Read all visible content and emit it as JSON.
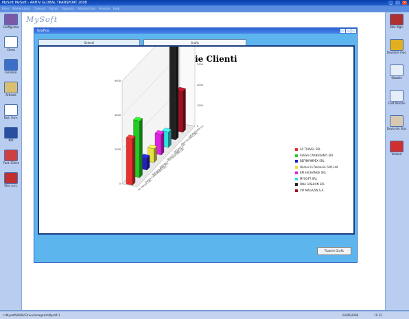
{
  "app": {
    "title": "MySoft MySoft - ARHIV GLOBAL TRANSPORT 2008",
    "menu": [
      "Fișier",
      "Nomenclator",
      "Comenzi",
      "Facturi",
      "Rapoarte",
      "Administrare",
      "Ferestre",
      "Help"
    ],
    "logo": "MySoft"
  },
  "left_toolbar": [
    {
      "label": "Configurare",
      "icon": "config-icon",
      "color": "#7a5aa8"
    },
    {
      "label": "Client",
      "icon": "client-icon",
      "color": "#ffffff"
    },
    {
      "label": "Furnizori",
      "icon": "supplier-icon",
      "color": "#3c6fc8"
    },
    {
      "label": "Articole",
      "icon": "article-icon",
      "color": "#d8c070"
    },
    {
      "label": "Fact. Furn.",
      "icon": "invoice-in-icon",
      "color": "#ffffff"
    },
    {
      "label": "NIR",
      "icon": "nir-icon",
      "color": "#2a4fa0"
    },
    {
      "label": "Fact. Client",
      "icon": "invoice-out-icon",
      "color": "#d04040"
    },
    {
      "label": "Stoc curs.",
      "icon": "stock-icon",
      "color": "#c03030"
    }
  ],
  "right_toolbar": [
    {
      "label": "Stoc dign.",
      "icon": "stock-diag-icon",
      "color": "#b03030"
    },
    {
      "label": "Devizare mas.",
      "icon": "crown-icon",
      "color": "#e0b020"
    },
    {
      "label": "Situatie",
      "icon": "report-icon",
      "color": "#e8eef8"
    },
    {
      "label": "Cost Vanzari",
      "icon": "sales-icon",
      "color": "#e8eef8"
    },
    {
      "label": "Deviz din Stoc",
      "icon": "person-icon",
      "color": "#d8c8b0"
    },
    {
      "label": "Vanzari",
      "icon": "bag-icon",
      "color": "#d03030"
    }
  ],
  "window": {
    "title": "Grafice",
    "tabs": [
      "Selectii",
      "Grafic"
    ],
    "print_button": "Tiparire Grafic"
  },
  "chart_data": {
    "type": "bar",
    "title": "Repartitie Clienti",
    "categories": [
      "AS TRAVEL SRL",
      "AVESA CARBURANTI SRL",
      "BEFIMPIMPEX SRL",
      "Homes in Romania (UK) Ltd",
      "EM EXCHANGE SRL",
      "MYSOFT SRL",
      "DNA FASHION SRL",
      "VIP MAGAZIN S.A."
    ],
    "values": [
      2700,
      3300,
      700,
      800,
      1200,
      900,
      5800,
      2400
    ],
    "colors": [
      "#e83030",
      "#22cc22",
      "#2020c0",
      "#e8e040",
      "#e020e0",
      "#30e0e0",
      "#222222",
      "#a01020"
    ],
    "y_ticks": [
      "0",
      "1000",
      "2000",
      "3000",
      "4000",
      "5000"
    ],
    "back_y_ticks": [
      "0",
      "2000",
      "4000",
      "6000"
    ],
    "legend_placement": "right",
    "grid": true
  },
  "status": {
    "path": "L:\\Mysoft\\ARHIV-Drivuri\\magazin\\Mysoft-1",
    "date": "03/06/2008",
    "time": "11:32"
  }
}
